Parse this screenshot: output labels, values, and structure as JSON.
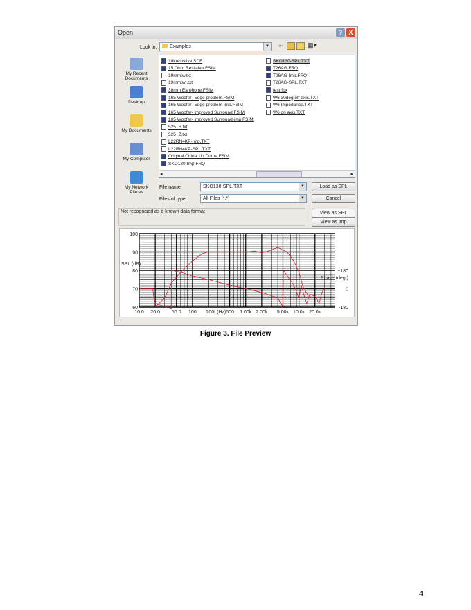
{
  "dialog": {
    "title": "Open",
    "help": "?",
    "close": "X",
    "look_in_label": "Look in:",
    "look_in_value": "Examples",
    "places": [
      "My Recent Documents",
      "Desktop",
      "My Documents",
      "My Computer",
      "My Network Places"
    ],
    "files_col1": [
      {
        "name": "10kresistive.SDF",
        "type": "doc"
      },
      {
        "name": "15 Ohm Resistive.FSIM",
        "type": "doc"
      },
      {
        "name": "19mmtw.txt",
        "type": "txt"
      },
      {
        "name": "19mmtwt.txt",
        "type": "txt"
      },
      {
        "name": "38mm Earphone.FSIM",
        "type": "doc"
      },
      {
        "name": "165 Woofer- Edge problem.FSIM",
        "type": "doc"
      },
      {
        "name": "165 Woofer- Edge problem-imp.FSIM",
        "type": "doc"
      },
      {
        "name": "165 Woofer- improved Surround.FSIM",
        "type": "doc"
      },
      {
        "name": "165 Woofer- improved Surround-imp.FSIM",
        "type": "doc"
      },
      {
        "name": "525_S.txt",
        "type": "txt"
      },
      {
        "name": "525_Z.txt",
        "type": "txt"
      },
      {
        "name": "L22RN4KP-Imp.TXT",
        "type": "txt"
      },
      {
        "name": "L22RN4KP-SPL.TXT",
        "type": "txt"
      },
      {
        "name": "Original China 1in Dome.FSIM",
        "type": "doc"
      },
      {
        "name": "SKO130-Imp.FRQ",
        "type": "doc"
      }
    ],
    "files_col2": [
      {
        "name": "SKO130-SPL.TXT",
        "type": "txt",
        "selected": true
      },
      {
        "name": "T26AG.FRQ",
        "type": "doc"
      },
      {
        "name": "T26AG-Imp.FRQ",
        "type": "doc"
      },
      {
        "name": "T26AG-SPL.TXT",
        "type": "txt"
      },
      {
        "name": "test.fbx",
        "type": "doc"
      },
      {
        "name": "W6 30deg off axis.TXT",
        "type": "txt"
      },
      {
        "name": "W6 Impedance.TXT",
        "type": "txt"
      },
      {
        "name": "W6 on axis.TXT",
        "type": "txt"
      }
    ],
    "file_name_label": "File name:",
    "file_name_value": "SKO130-SPL.TXT",
    "file_type_label": "Files of type:",
    "file_type_value": "All Files (*.*)",
    "load_button": "Load as SPL",
    "cancel_button": "Cancel",
    "status": "Not recognised as a known data format",
    "view_spl_button": "View as SPL",
    "view_imp_button": "View as Imp"
  },
  "chart_data": {
    "type": "line",
    "xscale": "log",
    "xlim": [
      10,
      48000
    ],
    "ylim": [
      60,
      100
    ],
    "ylabel": "SPL (dB)",
    "y2label": "Phase (deg.)",
    "xlabel": "f (Hz)",
    "yticks": [
      "60",
      "70",
      "80",
      "90",
      "100"
    ],
    "y2ticks": [
      {
        "label": "+180",
        "at": 80
      },
      {
        "label": "0",
        "at": 70
      },
      {
        "label": "-180",
        "at": 60
      }
    ],
    "xticks": [
      {
        "label": "10.0",
        "at": 10
      },
      {
        "label": "20.0",
        "at": 20
      },
      {
        "label": "50.0",
        "at": 50
      },
      {
        "label": "100",
        "at": 100
      },
      {
        "label": "200f (Hz)500",
        "at": 330
      },
      {
        "label": "1.00k",
        "at": 1000
      },
      {
        "label": "2.00k",
        "at": 2000
      },
      {
        "label": "5.00k",
        "at": 5000
      },
      {
        "label": "10.0k",
        "at": 10000
      },
      {
        "label": "20.0k",
        "at": 20000
      }
    ],
    "series": [
      {
        "name": "SPL",
        "x": [
          20,
          30,
          40,
          60,
          100,
          150,
          200,
          500,
          1000,
          1500,
          2000,
          3000,
          4000,
          5000,
          6000,
          8000,
          10000,
          12000,
          15000
        ],
        "y": [
          60,
          65,
          73,
          79,
          85,
          89,
          90,
          90,
          90,
          90.5,
          89.5,
          91,
          92.5,
          91,
          90,
          85,
          79,
          71,
          66
        ]
      },
      {
        "name": "Phase",
        "x": [
          10,
          18,
          19,
          20,
          40,
          40.1,
          60,
          100,
          200,
          500,
          1000,
          2000,
          4000,
          5000,
          5100,
          8000,
          10000,
          11000,
          12000,
          14000,
          16000,
          20000,
          24000,
          27000,
          30000
        ],
        "y": [
          70,
          70,
          64,
          62,
          59,
          80,
          79,
          77,
          75,
          72,
          70,
          68,
          65,
          60,
          80,
          72,
          65,
          72,
          68,
          62,
          67,
          66,
          62,
          68,
          70
        ]
      }
    ],
    "color": "#d02030"
  },
  "caption": "Figure 3.  File Preview",
  "page_number": "4"
}
